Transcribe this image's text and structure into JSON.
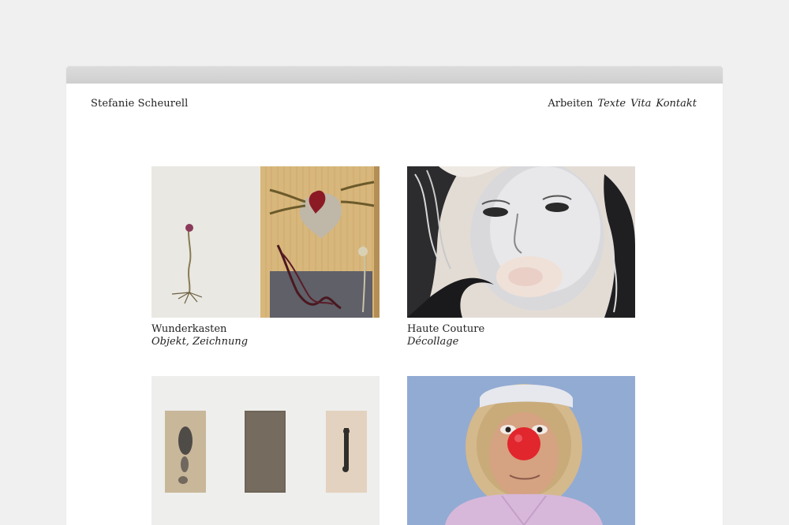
{
  "site": {
    "title": "Stefanie Scheurell"
  },
  "nav": {
    "items": [
      {
        "label": "Arbeiten",
        "style": "normal"
      },
      {
        "label": "Texte",
        "style": "italic"
      },
      {
        "label": "Vita",
        "style": "italic"
      },
      {
        "label": "Kontakt",
        "style": "italic"
      }
    ]
  },
  "works": [
    {
      "title": "Wunderkasten",
      "subtitle": "Objekt, Zeichnung"
    },
    {
      "title": "Haute Couture",
      "subtitle": "Décollage"
    },
    {
      "title": "",
      "subtitle": ""
    },
    {
      "title": "",
      "subtitle": ""
    }
  ],
  "colors": {
    "page_bg": "#f0f0f0",
    "window_bg": "#ffffff",
    "text": "#222222"
  }
}
